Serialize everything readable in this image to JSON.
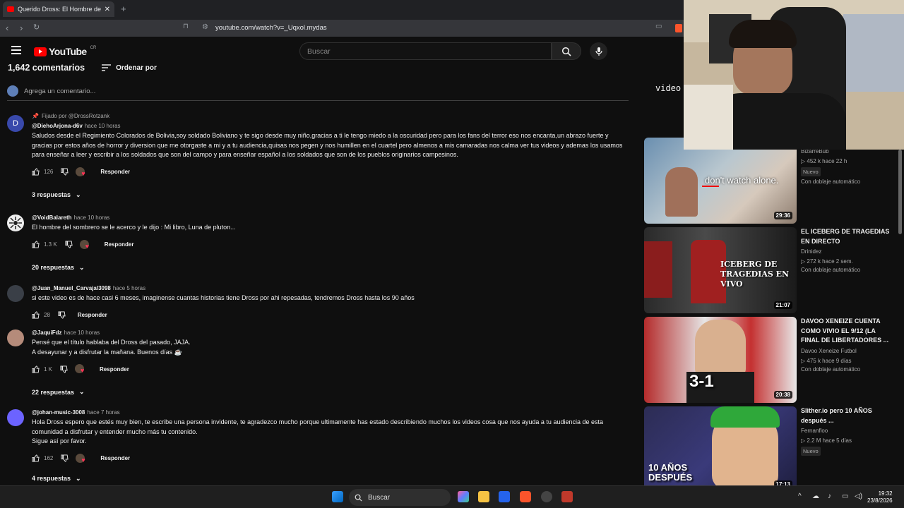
{
  "browser": {
    "tab_title": "Querido Dross: El Hombre del So",
    "tab_close": "✕",
    "new_tab": "+",
    "url": "youtube.com/watch?v=_Uqxol.mydas"
  },
  "yt": {
    "logo_text": "YouTube",
    "country": "CR",
    "search_placeholder": "Buscar"
  },
  "comments_header": {
    "count": "1,642 comentarios",
    "sort_label": "Ordenar por",
    "add_placeholder": "Agrega un comentario..."
  },
  "comments": [
    {
      "avatar_letter": "D",
      "pinned": "Fijado por @DrossRotzank",
      "author": "@DiehoArjona-d6v",
      "time": "hace 10 horas",
      "text": "Saludos desde el Regimiento Colorados de Bolivia,soy soldado Boliviano y te sigo desde muy niño,gracias a ti le tengo miedo a la oscuridad pero para los fans del terror eso nos encanta,un abrazo fuerte y gracias por estos años de horror y diversion que me otorgaste a mi y a tu audiencia,quisas nos pegen y nos humillen en el cuartel pero almenos a mis camaradas nos calma ver tus videos y ademas los usamos para enseñar a leer y escribir a los soldados que son del campo y para enseñar español a los soldados que son de los pueblos originarios campesinos.",
      "likes": "126",
      "reply": "Responder",
      "replies": "3 respuestas"
    },
    {
      "avatar_letter": "",
      "author": "@VoidBalareth",
      "time": "hace 10 horas",
      "text": "El hombre del sombrero  se le acerco y le dijo : Mi libro, Luna de pluton...",
      "likes": "1.3 K",
      "reply": "Responder",
      "replies": "20 respuestas"
    },
    {
      "avatar_letter": "",
      "author": "@Juan_Manuel_Carvajal3098",
      "time": "hace 5 horas",
      "text": "si este video es de hace casi 6 meses, imaginense cuantas historias tiene Dross por ahi repesadas, tendremos Dross hasta los 90 años",
      "likes": "28",
      "reply": "Responder"
    },
    {
      "avatar_letter": "",
      "author": "@JaquiFdz",
      "time": "hace 10 horas",
      "text_line1": "Pensé que el título hablaba del Dross del pasado, JAJA.",
      "text_line2": "A desayunar y a disfrutar la mañana. Buenos días ☕",
      "likes": "1 K",
      "reply": "Responder",
      "replies": "22 respuestas"
    },
    {
      "avatar_letter": "",
      "author": "@johan-music-3008",
      "time": "hace 7 horas",
      "text": "Hola Dross espero que estés muy bien, te escribe una persona invidente, te agradezco mucho porque ultimamente has estado describiendo muchos los videos cosa que nos ayuda a tu audiencia de esta comunidad a disfrutar y entender mucho más tu contenido.",
      "text_line2": "Sigue así por favor.",
      "likes": "162",
      "reply": "Responder",
      "replies": "4 respuestas"
    }
  ],
  "sidebar": {
    "partial_text": "video",
    "videos": [
      {
        "thumb_text": "don't watch alone.",
        "duration": "29:36",
        "channel": "BizarreBub",
        "stats": "▷ 452 k  hace 22 h",
        "badge": "Nuevo",
        "dub": "Con doblaje automático"
      },
      {
        "thumb_text": "ICEBERG DE TRAGEDIAS EN VIVO",
        "duration": "21:07",
        "title": "EL ICEBERG DE TRAGEDIAS EN DIRECTO",
        "channel": "Drinidez",
        "stats": "▷ 272 k  hace 2 sem.",
        "dub": "Con doblaje automático"
      },
      {
        "thumb_text": "3-1",
        "duration": "20:38",
        "title": "DAVOO XENEIZE CUENTA COMO VIVIO EL 9/12 (LA FINAL DE LIBERTADORES ...",
        "channel": "Davoo Xeneize Futbol",
        "stats": "▷ 475 k  hace 9 días",
        "dub": "Con doblaje automático"
      },
      {
        "thumb_text": "10 AÑOS DESPUÉS",
        "duration": "17:13",
        "title": "Slither.io pero 10 AÑOS después ...",
        "channel": "Fernanfloo",
        "stats": "▷ 2.2 M  hace 5 días",
        "badge": "Nuevo"
      }
    ]
  },
  "taskbar": {
    "search": "Buscar",
    "time": "19:32",
    "date": "23/8/2026"
  },
  "colors": {
    "bg": "#0f0f0f",
    "accent_red": "#ff0000",
    "text": "#f1f1f1",
    "muted": "#aaaaaa"
  }
}
